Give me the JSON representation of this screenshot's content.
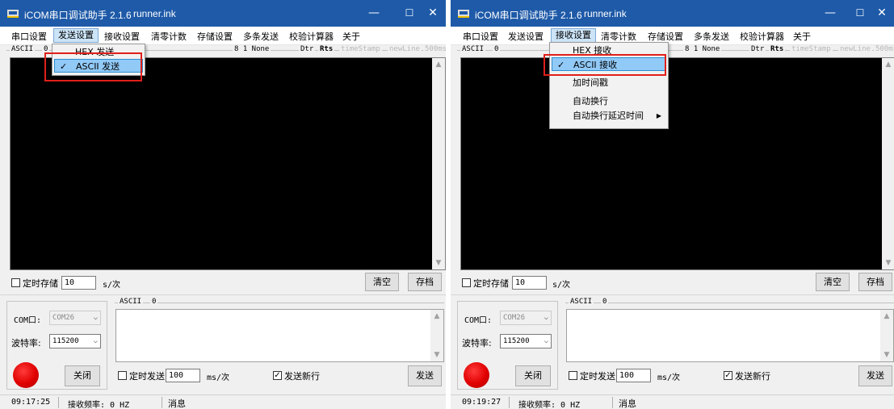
{
  "app": {
    "title": "iCOM串口调试助手 2.1.6",
    "file": "runner.ink",
    "minimize": "—",
    "maximize": "☐",
    "close": "✕"
  },
  "menu": [
    "串口设置",
    "发送设置",
    "接收设置",
    "清零计数",
    "存储设置",
    "多条发送",
    "校验计算器",
    "关于"
  ],
  "recv_group": {
    "mode": "ASCII",
    "count": "0",
    "config": "8  1  None",
    "dtr": "Dtr",
    "rts": "Rts",
    "timestamp": "timeStamp",
    "newline": "newLine",
    "interval": "500ms"
  },
  "save_row": {
    "timed_save": "定时存储",
    "interval_value": "10",
    "unit": "s/次",
    "clear": "清空",
    "archive": "存档"
  },
  "port": {
    "com_label": "COM口:",
    "com_value": "COM26",
    "baud_label": "波特率:",
    "baud_value": "115200",
    "close": "关闭"
  },
  "send_group": {
    "mode": "ASCII",
    "count": "0",
    "timed_send": "定时发送",
    "interval_value": "100",
    "unit": "ms/次",
    "newline": "发送新行",
    "send": "发送"
  },
  "status": {
    "freq": "接收频率: 0 HZ",
    "msg": "消息"
  },
  "window1": {
    "time": "09:17:25",
    "open_menu": "发送设置",
    "dropdown": [
      {
        "label": "HEX 发送",
        "checked": false,
        "selected": false
      },
      {
        "label": "ASCII 发送",
        "checked": true,
        "selected": true
      }
    ]
  },
  "window2": {
    "time": "09:19:27",
    "open_menu": "接收设置",
    "dropdown": [
      {
        "label": "HEX 接收",
        "checked": false,
        "selected": false
      },
      {
        "label": "ASCII 接收",
        "checked": true,
        "selected": true
      },
      {
        "label": "加时间戳",
        "checked": false,
        "selected": false
      },
      {
        "label": "自动换行",
        "checked": false,
        "selected": false
      },
      {
        "label": "自动换行延迟时间",
        "checked": false,
        "selected": false,
        "submenu": true
      }
    ]
  },
  "colors": {
    "titlebar": "#1e5aa8",
    "highlight": "#91c9f7",
    "annotation": "#e0201a",
    "led": "#e00000"
  }
}
